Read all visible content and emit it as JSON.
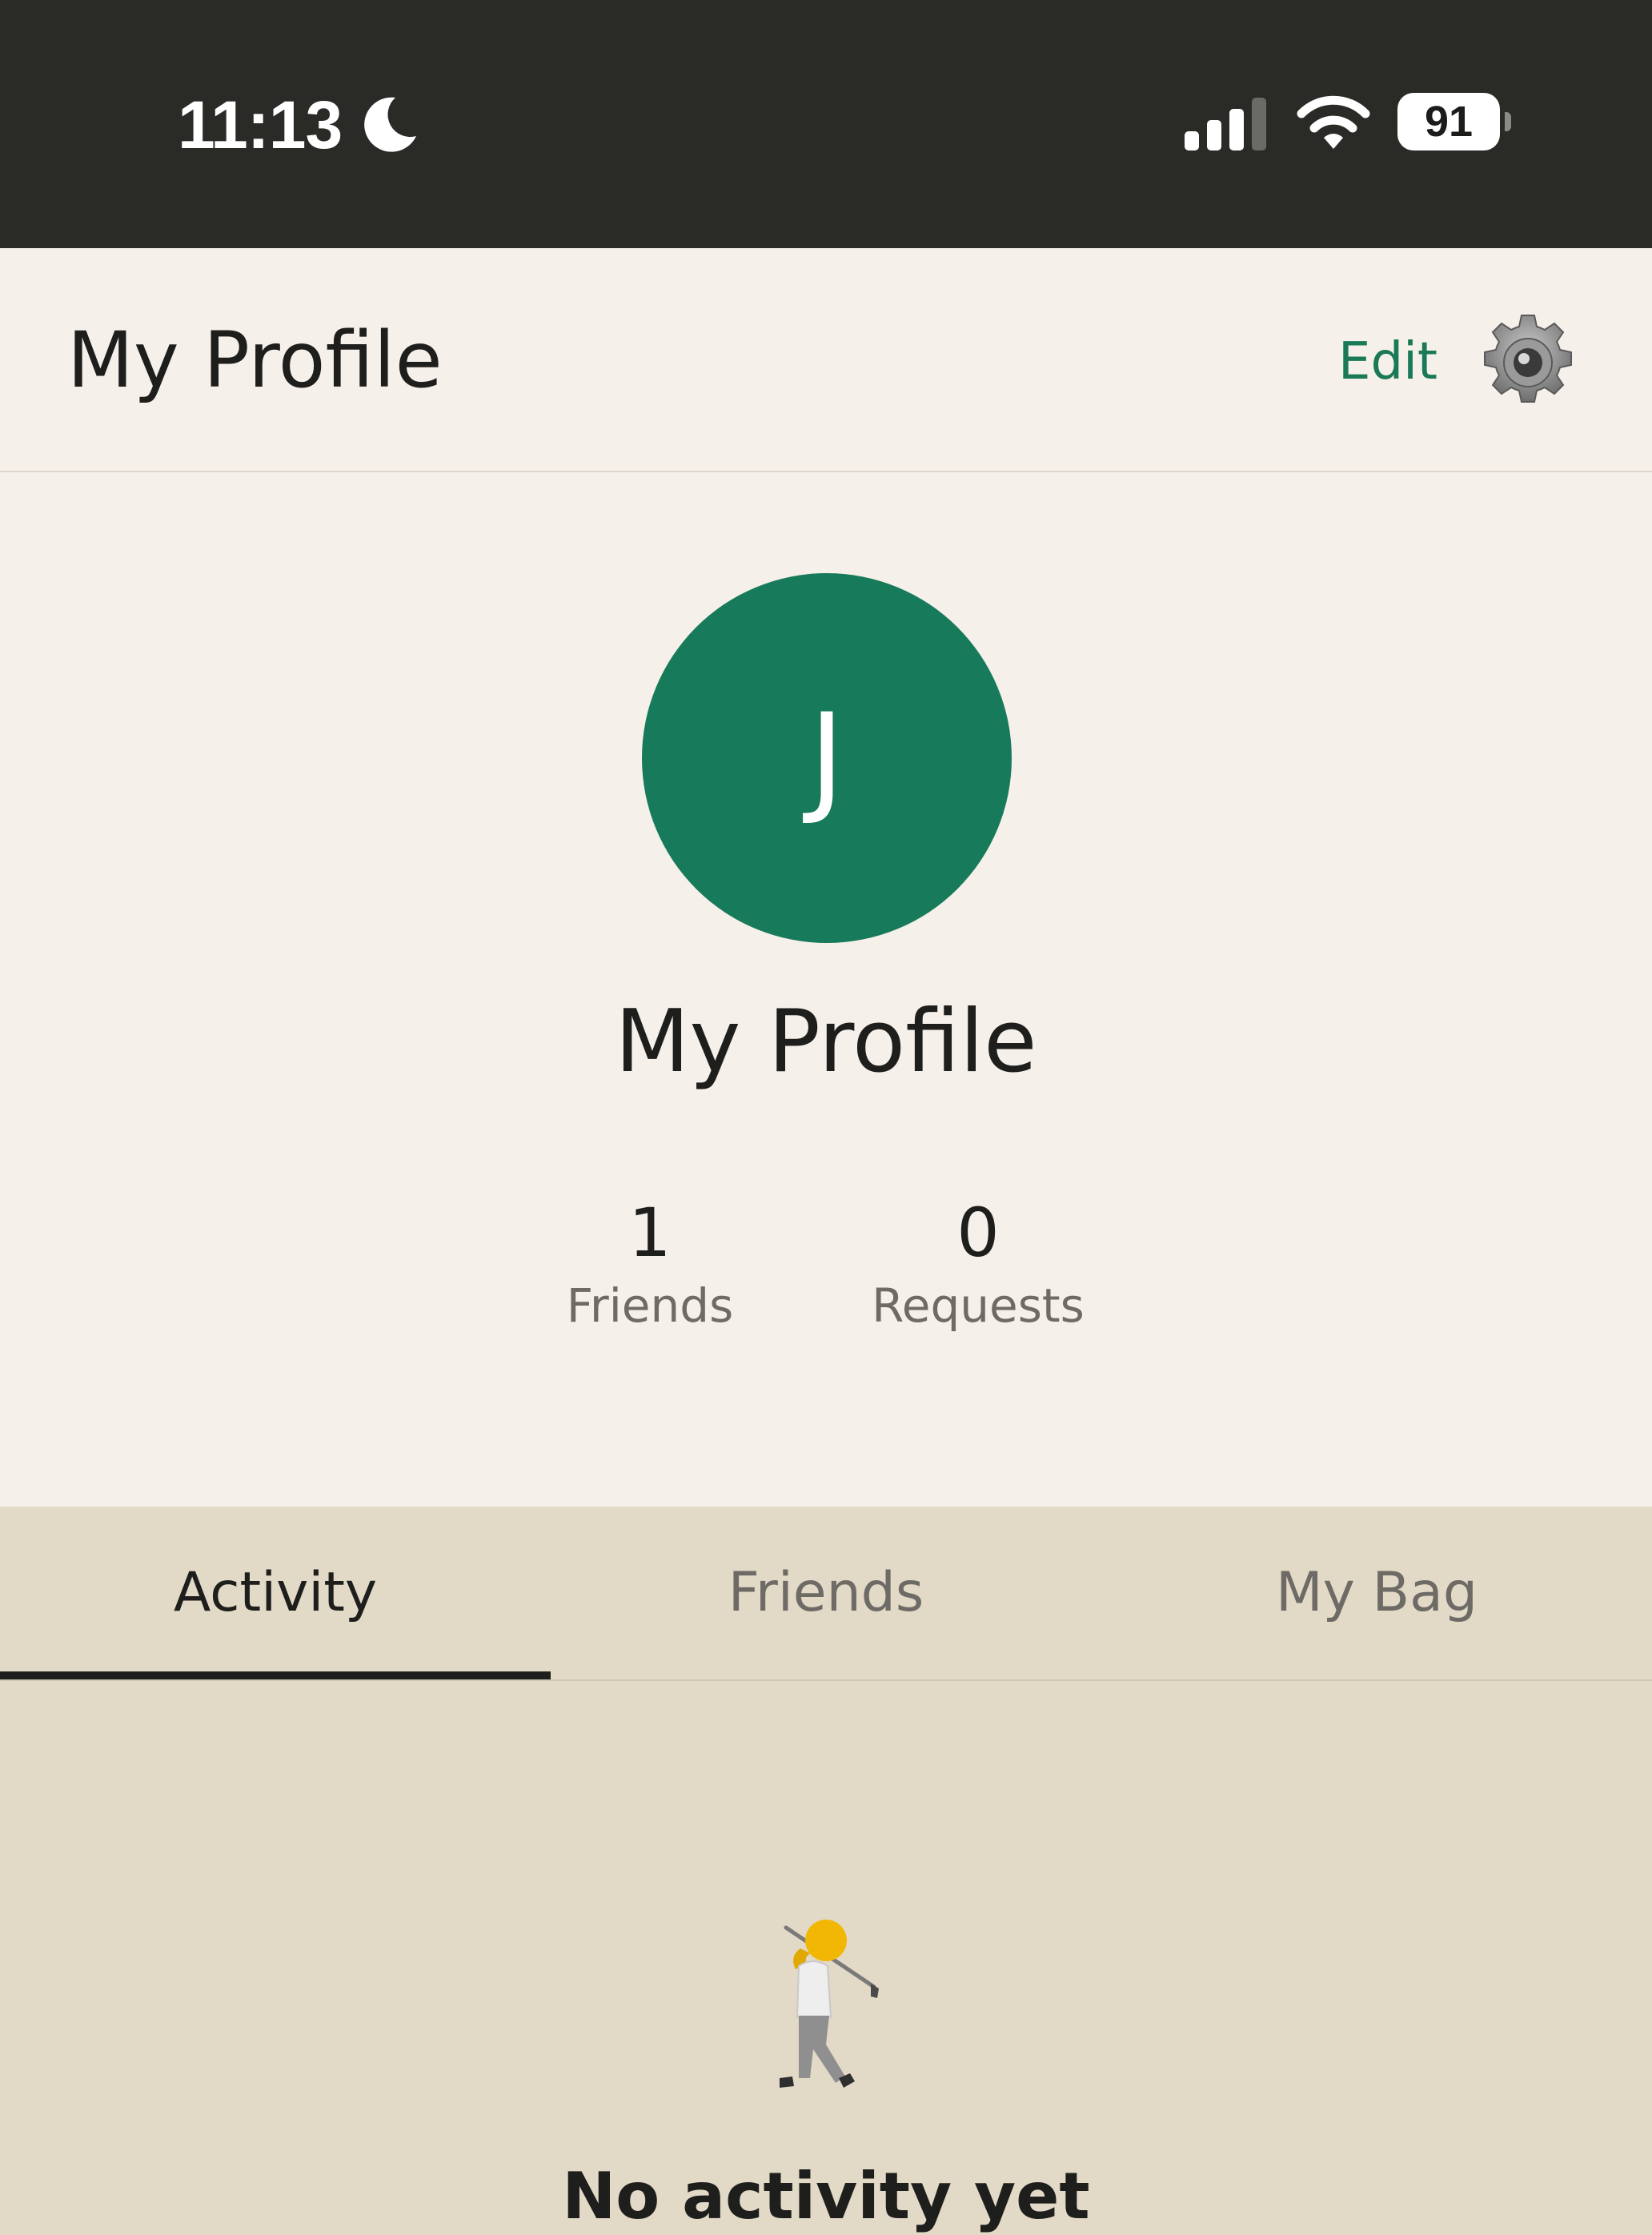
{
  "status_bar": {
    "time": "11:13",
    "battery_level": "91",
    "icons": [
      "moon-icon",
      "signal-icon",
      "wifi-icon",
      "battery-icon"
    ]
  },
  "header": {
    "title": "My Profile",
    "edit_label": "Edit",
    "settings_icon": "gear-icon"
  },
  "profile": {
    "avatar_initial": "J",
    "avatar_color": "#177a5a",
    "name": "My Profile",
    "stats": [
      {
        "value": "1",
        "label": "Friends"
      },
      {
        "value": "0",
        "label": "Requests"
      }
    ]
  },
  "tabs": [
    {
      "label": "Activity",
      "active": true
    },
    {
      "label": "Friends",
      "active": false
    },
    {
      "label": "My Bag",
      "active": false
    }
  ],
  "empty_state": {
    "icon": "golfer-icon",
    "title": "No activity yet"
  },
  "colors": {
    "accent": "#1a7a57",
    "header_background": "#f5f0e9",
    "tab_background": "#e2dac7",
    "status_bar_background": "#2a2a26"
  }
}
